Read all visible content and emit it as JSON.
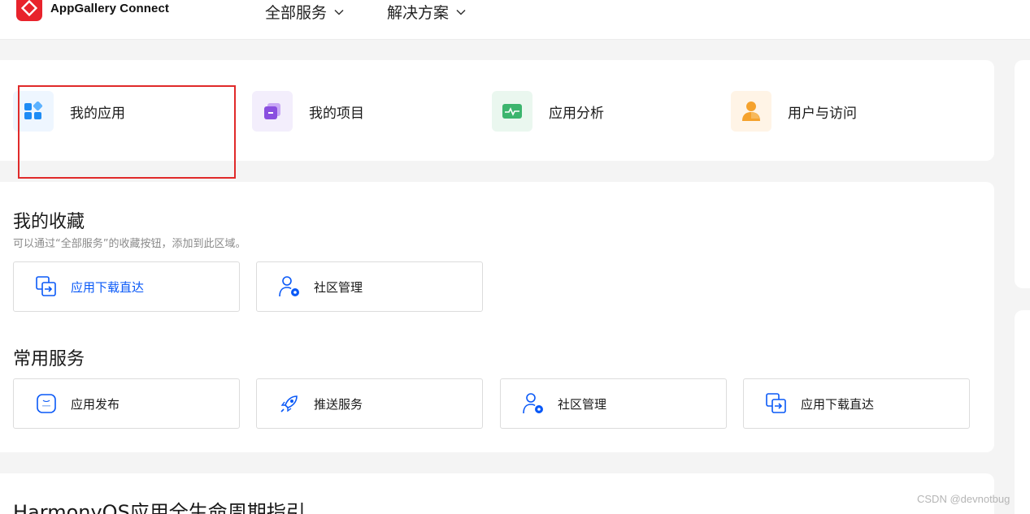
{
  "header": {
    "brand": "AppGallery Connect",
    "nav": [
      {
        "label": "全部服务"
      },
      {
        "label": "解决方案"
      }
    ]
  },
  "quick_access": [
    {
      "label": "我的应用",
      "icon": "apps-grid-icon",
      "color": "#1e8cf5",
      "bg": "#eef6ff"
    },
    {
      "label": "我的项目",
      "icon": "projects-icon",
      "color": "#8a4fe0",
      "bg": "#f3eefc"
    },
    {
      "label": "应用分析",
      "icon": "analytics-icon",
      "color": "#3cb56e",
      "bg": "#eaf7ef"
    },
    {
      "label": "用户与访问",
      "icon": "user-access-icon",
      "color": "#f5a22d",
      "bg": "#fff4e6"
    }
  ],
  "favorites": {
    "title": "我的收藏",
    "subtitle": "可以通过“全部服务”的收藏按钮，添加到此区域。",
    "items": [
      {
        "label": "应用下载直达",
        "icon": "download-direct-icon"
      },
      {
        "label": "社区管理",
        "icon": "community-manage-icon"
      }
    ]
  },
  "common": {
    "title": "常用服务",
    "items": [
      {
        "label": "应用发布",
        "icon": "app-release-icon"
      },
      {
        "label": "推送服务",
        "icon": "push-rocket-icon"
      },
      {
        "label": "社区管理",
        "icon": "community-manage-icon"
      },
      {
        "label": "应用下载直达",
        "icon": "download-direct-icon"
      }
    ]
  },
  "guide": {
    "title": "HarmonyOS应用全生命周期指引"
  },
  "watermark": "CSDN @devnotbug",
  "colors": {
    "accent_blue": "#0a59f7",
    "brand_red": "#e8232c",
    "highlight_box": "#e02a2a"
  }
}
